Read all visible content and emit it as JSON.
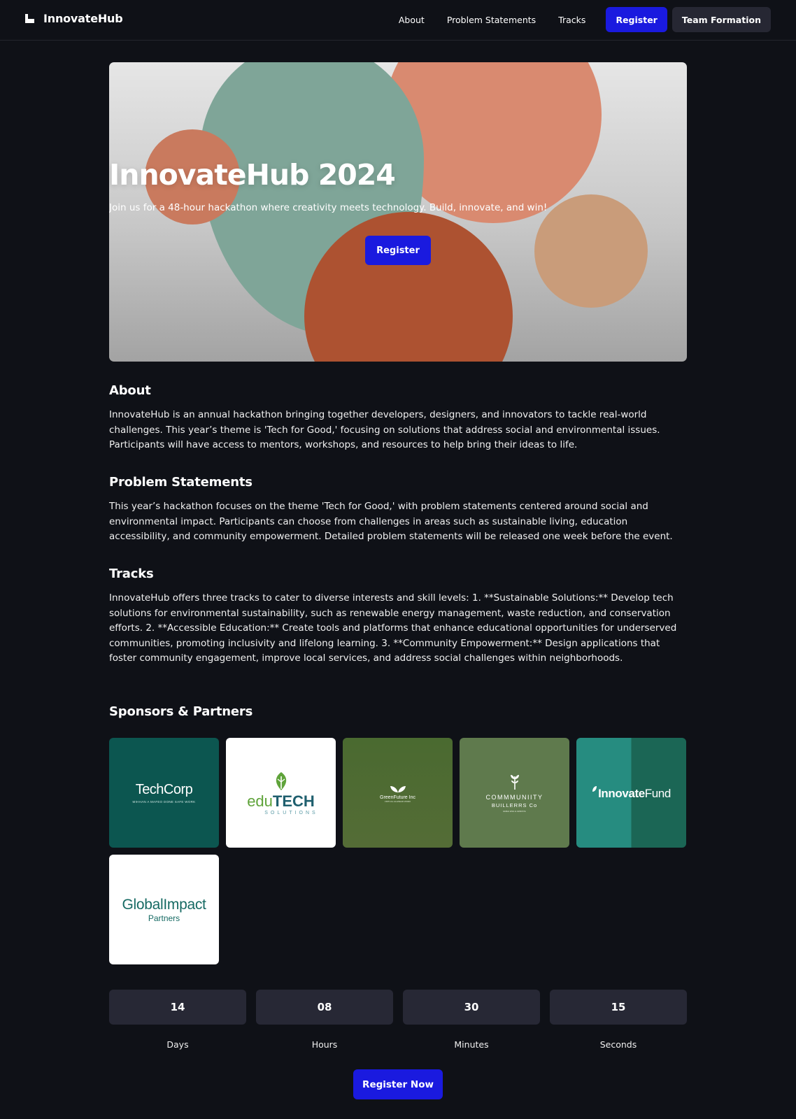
{
  "header": {
    "brand": "InnovateHub",
    "nav": [
      "About",
      "Problem Statements",
      "Tracks"
    ],
    "register_label": "Register",
    "team_label": "Team Formation"
  },
  "hero": {
    "title": "InnovateHub 2024",
    "subtitle": "Join us for a 48-hour hackathon where creativity meets technology. Build, innovate, and win!",
    "cta": "Register"
  },
  "about": {
    "title": "About",
    "body": "InnovateHub is an annual hackathon bringing together developers, designers, and innovators to tackle real-world challenges. This year’s theme is 'Tech for Good,' focusing on solutions that address social and environmental issues. Participants will have access to mentors, workshops, and resources to help bring their ideas to life."
  },
  "problems": {
    "title": "Problem Statements",
    "body": "This year’s hackathon focuses on the theme 'Tech for Good,' with problem statements centered around social and environmental impact. Participants can choose from challenges in areas such as sustainable living, education accessibility, and community empowerment. Detailed problem statements will be released one week before the event."
  },
  "tracks": {
    "title": "Tracks",
    "body": "InnovateHub offers three tracks to cater to diverse interests and skill levels: 1. **Sustainable Solutions:** Develop tech solutions for environmental sustainability, such as renewable energy management, waste reduction, and conservation efforts. 2. **Accessible Education:** Create tools and platforms that enhance educational opportunities for underserved communities, promoting inclusivity and lifelong learning. 3. **Community Empowerment:** Design applications that foster community engagement, improve local services, and address social challenges within neighborhoods."
  },
  "sponsors": {
    "title": "Sponsors & Partners",
    "items": [
      {
        "name": "TechCorp",
        "tagline": "MIHHAN A MAFEO DONE SAFE WORK",
        "bg": "#0c5650"
      },
      {
        "name_a": "edu",
        "name_b": "TECH",
        "tagline": "SOLUTIONS",
        "bg": "#ffffff"
      },
      {
        "name": "GreenFuture Inc",
        "tagline": "VIRTUAL ALLWEAR WORK",
        "bg": "#4e6a32"
      },
      {
        "name_a": "COMMMUNIITY",
        "name_b": "BUILLERRS Co",
        "tagline": "EMEH ENG E AWESYE",
        "bg": "#5f7a4d"
      },
      {
        "name_a": "Innovate",
        "name_b": "Fund",
        "bg": "#1b6655"
      },
      {
        "name_a": "GlobalImpact",
        "name_b": "Partners",
        "bg": "#ffffff"
      }
    ]
  },
  "countdown": [
    {
      "value": "14",
      "label": "Days"
    },
    {
      "value": "08",
      "label": "Hours"
    },
    {
      "value": "30",
      "label": "Minutes"
    },
    {
      "value": "15",
      "label": "Seconds"
    }
  ],
  "register_now": "Register Now",
  "colors": {
    "accent": "#1a1adf",
    "background": "#0f1117",
    "card": "#272835"
  }
}
